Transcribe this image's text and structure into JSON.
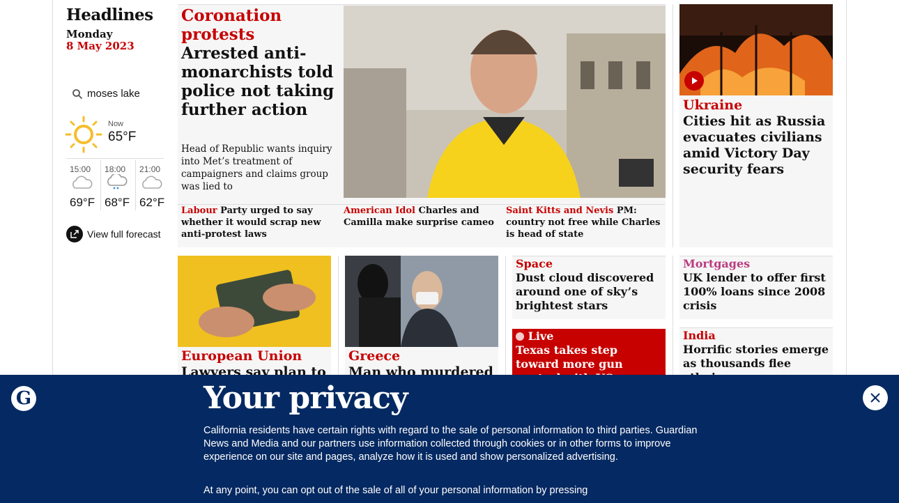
{
  "left": {
    "section_title": "Headlines",
    "day": "Monday",
    "date": "8 May 2023",
    "search_value": "moses lake",
    "now_label": "Now",
    "now_temp": "65°F",
    "forecast": [
      {
        "time": "15:00",
        "temp": "69°F",
        "icon": "cloud-icon"
      },
      {
        "time": "18:00",
        "temp": "68°F",
        "icon": "rain-cloud-icon"
      },
      {
        "time": "21:00",
        "temp": "62°F",
        "icon": "cloud-icon"
      }
    ],
    "full_forecast_label": "View full forecast"
  },
  "main": {
    "kicker": "Coronation protests",
    "headline": "Arrested anti-monarchists told police not taking further action",
    "standfirst": "Head of Republic wants inquiry into Met’s treatment of campaigners and claims group was lied to",
    "sublinks": [
      {
        "kicker": "Labour",
        "text": "Party urged to say whether it would scrap new anti-protest laws"
      },
      {
        "kicker": "American Idol",
        "text": "Charles and Camilla make surprise cameo"
      },
      {
        "kicker": "Saint Kitts and Nevis",
        "text": "PM: country not free while Charles is head of state"
      }
    ]
  },
  "right": {
    "kicker": "Ukraine",
    "headline": "Cities hit as Russia evacuates civilians amid Victory Day security fears"
  },
  "row2": {
    "eu": {
      "kicker": "European Union",
      "headline": "Lawyers say plan to"
    },
    "greece": {
      "kicker": "Greece",
      "headline": "Man who murdered"
    },
    "space": {
      "kicker": "Space",
      "headline": "Dust cloud discovered around one of sky’s brightest stars"
    },
    "live": {
      "kicker": "Live",
      "headline": "Texas takes step toward more gun control with US"
    },
    "mortgages": {
      "kicker": "Mortgages",
      "headline": "UK lender to offer first 100% loans since 2008 crisis"
    },
    "india": {
      "kicker": "India",
      "headline": "Horrific stories emerge as thousands flee ethnic"
    }
  },
  "banner": {
    "title": "Your privacy",
    "text": "California residents have certain rights with regard to the sale of personal information to third parties. Guardian News and Media and our partners use information collected through cookies or in other forms to improve experience on our site and pages, analyze how it is used and show personalized advertising.",
    "text2": "At any point, you can opt out of the sale of all of your personal information by pressing"
  },
  "colors": {
    "red": "#c70000",
    "navy": "#052962",
    "live": "#c70000",
    "mortgages_pink": "#bb3b80"
  }
}
